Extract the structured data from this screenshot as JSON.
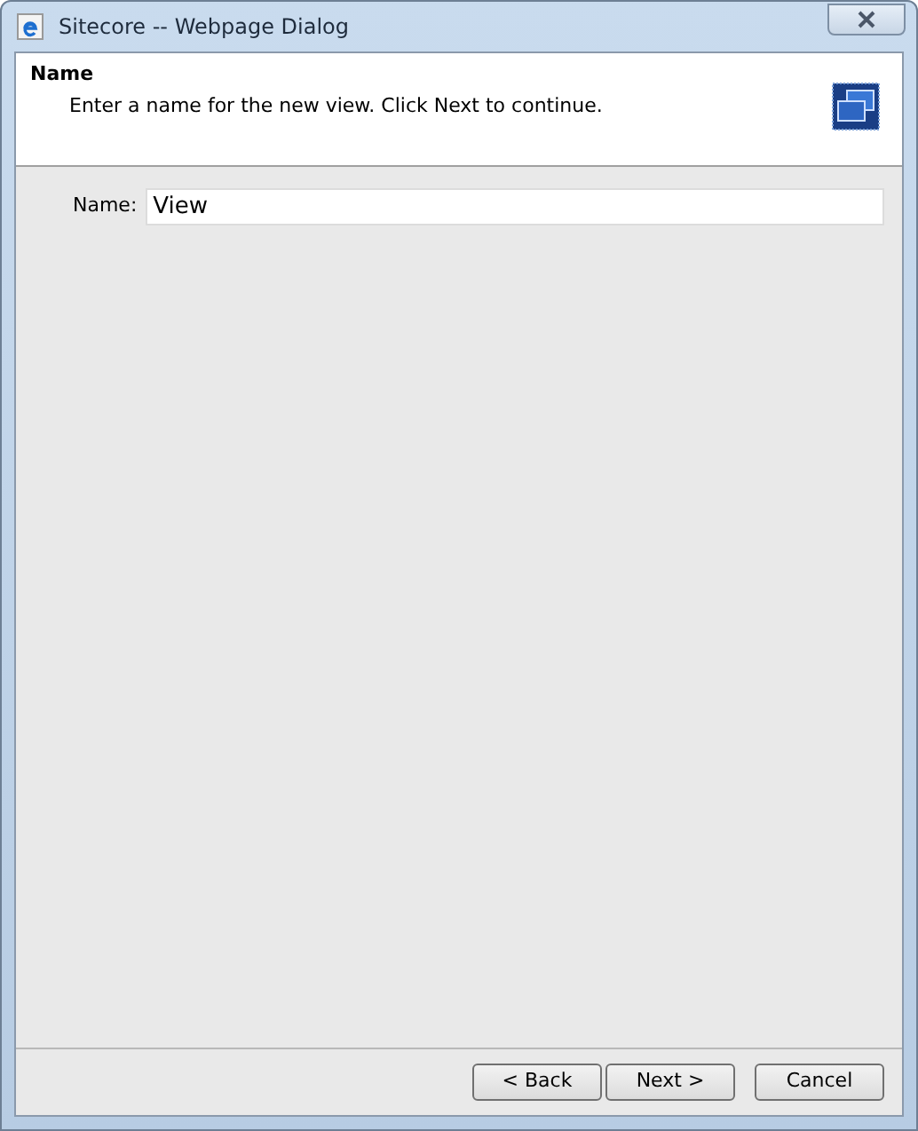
{
  "window": {
    "title": "Sitecore -- Webpage Dialog"
  },
  "header": {
    "title": "Name",
    "description": "Enter a name for the new view. Click Next to continue."
  },
  "form": {
    "label": "Name:",
    "value": "View"
  },
  "buttons": [
    {
      "label": "< Back"
    },
    {
      "label": "Next >"
    },
    {
      "label": "Cancel"
    }
  ]
}
